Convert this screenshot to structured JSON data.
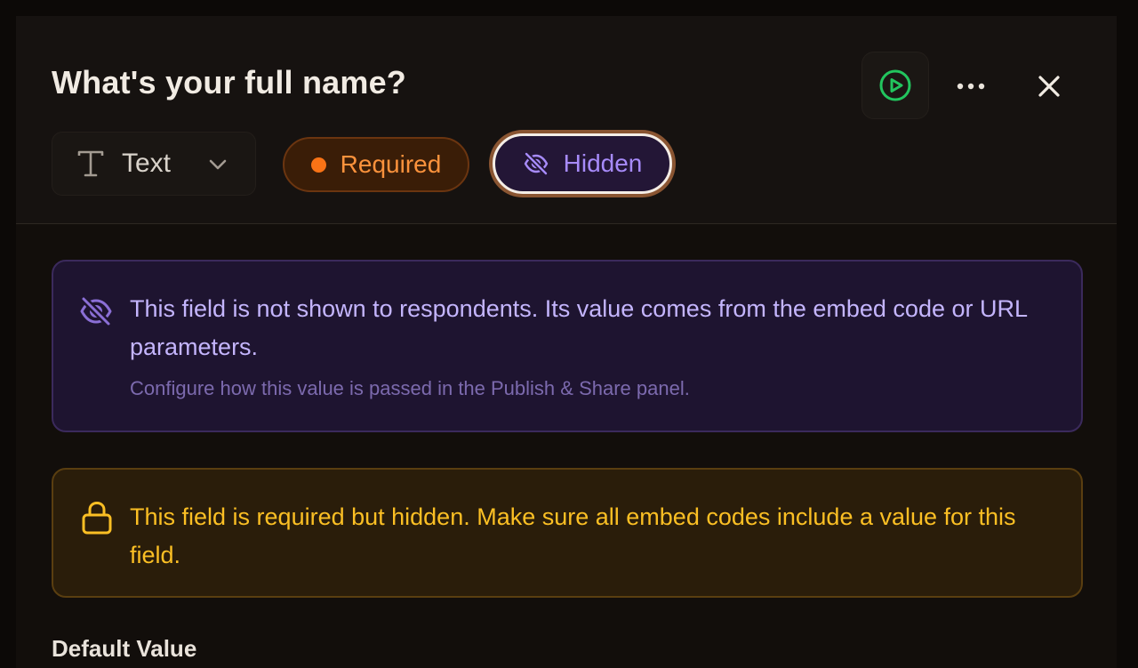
{
  "header": {
    "title": "What's your full name?"
  },
  "actions": {
    "preview_icon": "play-circle-icon",
    "more_icon": "more-horizontal-icon",
    "close_icon": "close-icon"
  },
  "field_type": {
    "icon": "text-type-icon",
    "label": "Text"
  },
  "toggles": {
    "required_label": "Required",
    "hidden_label": "Hidden"
  },
  "hidden_notice": {
    "icon": "eye-off-icon",
    "message": "This field is not shown to respondents. Its value comes from the embed code or URL parameters.",
    "hint": "Configure how this value is passed in the Publish & Share panel."
  },
  "required_warning": {
    "icon": "lock-icon",
    "message": "This field is required but hidden. Make sure all embed codes include a value for this field."
  },
  "default_value": {
    "label": "Default Value"
  },
  "colors": {
    "accent_green": "#22c55e",
    "required_orange": "#f97316",
    "hidden_purple": "#a78bfa",
    "warning_amber": "#fbbf24"
  }
}
